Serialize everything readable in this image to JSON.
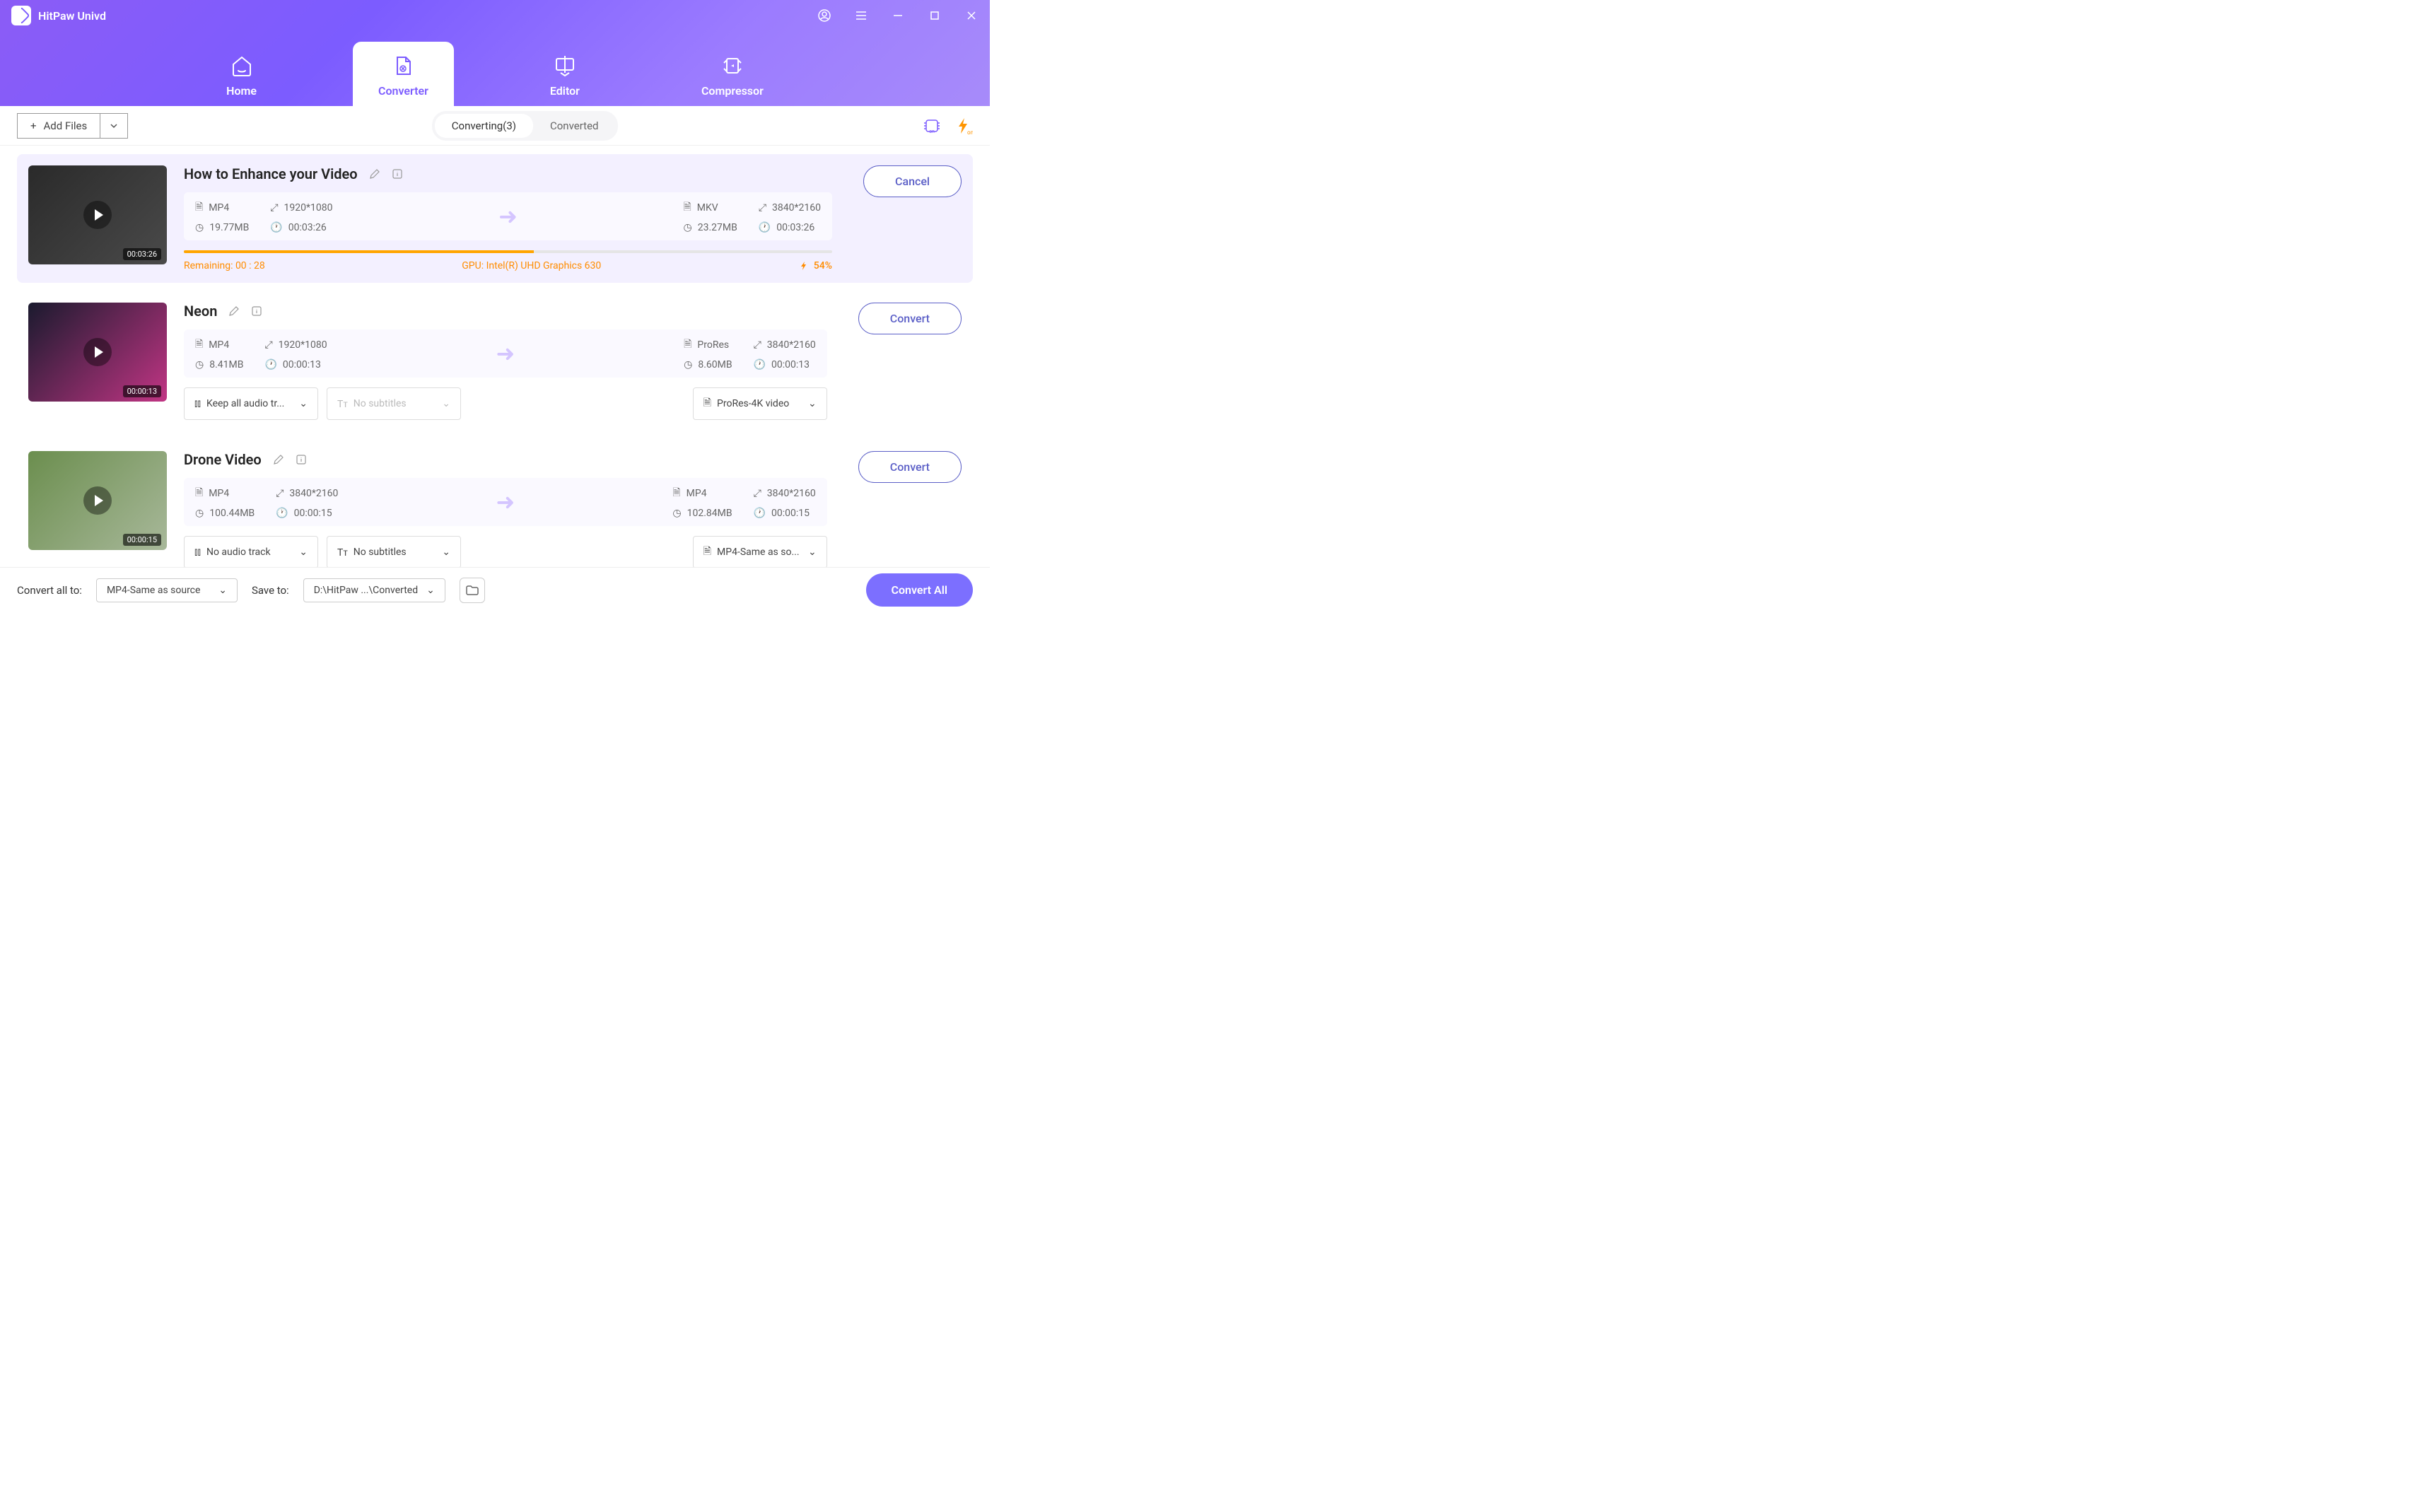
{
  "app": {
    "name": "HitPaw Univd"
  },
  "nav": {
    "tabs": [
      {
        "label": "Home"
      },
      {
        "label": "Converter"
      },
      {
        "label": "Editor"
      },
      {
        "label": "Compressor"
      }
    ]
  },
  "toolbar": {
    "add_files": "Add Files",
    "sub_tabs": {
      "converting": "Converting(3)",
      "converted": "Converted"
    }
  },
  "files": [
    {
      "title": "How to Enhance your Video",
      "src": {
        "fmt": "MP4",
        "res": "1920*1080",
        "size": "19.77MB",
        "dur": "00:03:26"
      },
      "dst": {
        "fmt": "MKV",
        "res": "3840*2160",
        "size": "23.27MB",
        "dur": "00:03:26"
      },
      "progress": {
        "remaining": "Remaining: 00 : 28",
        "gpu": "GPU: Intel(R) UHD Graphics 630",
        "pct": "54%",
        "pct_num": 54
      },
      "action": "Cancel",
      "thumb_time": "00:03:26"
    },
    {
      "title": "Neon",
      "src": {
        "fmt": "MP4",
        "res": "1920*1080",
        "size": "8.41MB",
        "dur": "00:00:13"
      },
      "dst": {
        "fmt": "ProRes",
        "res": "3840*2160",
        "size": "8.60MB",
        "dur": "00:00:13"
      },
      "dropdowns": {
        "audio": "Keep all audio tr...",
        "subs": "No subtitles",
        "out": "ProRes-4K video"
      },
      "action": "Convert",
      "thumb_time": "00:00:13"
    },
    {
      "title": "Drone Video",
      "src": {
        "fmt": "MP4",
        "res": "3840*2160",
        "size": "100.44MB",
        "dur": "00:00:15"
      },
      "dst": {
        "fmt": "MP4",
        "res": "3840*2160",
        "size": "102.84MB",
        "dur": "00:00:15"
      },
      "dropdowns": {
        "audio": "No audio track",
        "subs": "No subtitles",
        "out": "MP4-Same as so..."
      },
      "action": "Convert",
      "thumb_time": "00:00:15"
    }
  ],
  "bottom": {
    "convert_all_to_label": "Convert all to:",
    "convert_all_to_value": "MP4-Same as source",
    "save_to_label": "Save to:",
    "save_to_value": "D:\\HitPaw ...\\Converted",
    "convert_all": "Convert All"
  }
}
